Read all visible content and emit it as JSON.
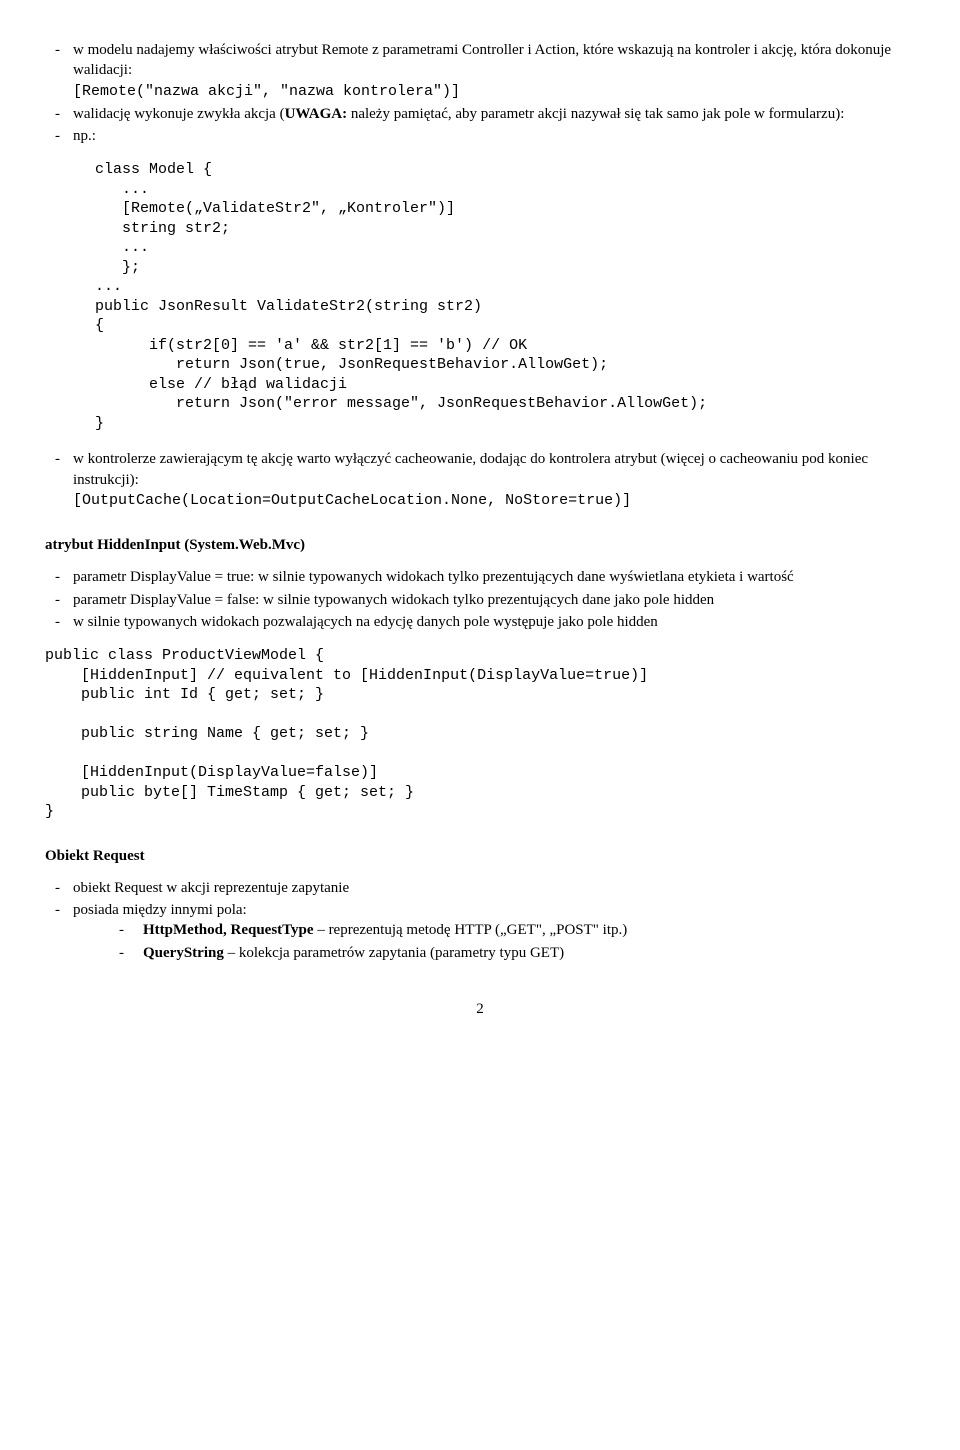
{
  "bullets_top": [
    "w modelu nadajemy właściwości atrybut Remote z parametrami Controller i Action, które wskazują na kontroler i akcję, która dokonuje walidacji:",
    "walidację wykonuje zwykła akcja (",
    "np.:"
  ],
  "bullets_top_remote": "[Remote(″nazwa akcji″, ″nazwa kontrolera″)]",
  "bullets_top_uwaga": "UWAGA:",
  "bullets_top_uwaga_rest": " należy pamiętać, aby parametr akcji nazywał się tak samo jak pole w formularzu):",
  "code1": "class Model {\n   ...\n   [Remote(„ValidateStr2″, „Kontroler″)]\n   string str2;\n   ...\n   };\n...\npublic JsonResult ValidateStr2(string str2)\n{\n      if(str2[0] == 'a' && str2[1] == 'b') // OK\n         return Json(true, JsonRequestBehavior.AllowGet);\n      else // błąd walidacji\n         return Json(\"error message\", JsonRequestBehavior.AllowGet);\n}",
  "bullet_cache_pre": "w kontrolerze zawierającym tę akcję warto wyłączyć cacheowanie, dodając do kontrolera atrybut (więcej o cacheowaniu pod koniec instrukcji):",
  "bullet_cache_code": "[OutputCache(Location=OutputCacheLocation.None, NoStore=true)]",
  "section_hidden": "atrybut HiddenInput (System.Web.Mvc)",
  "bullets_hidden": [
    "parametr DisplayValue = true: w silnie typowanych widokach tylko prezentujących dane wyświetlana etykieta i wartość",
    "parametr DisplayValue = false: w silnie typowanych widokach tylko prezentujących dane jako pole hidden",
    "w silnie typowanych widokach pozwalających na edycję danych pole występuje jako pole hidden"
  ],
  "code2": "public class ProductViewModel {\n    [HiddenInput] // equivalent to [HiddenInput(DisplayValue=true)]\n    public int Id { get; set; }\n\n    public string Name { get; set; }\n\n    [HiddenInput(DisplayValue=false)]\n    public byte[] TimeStamp { get; set; }\n}",
  "section_request": "Obiekt Request",
  "bullets_request": [
    "obiekt Request w akcji reprezentuje zapytanie",
    "posiada między innymi pola:"
  ],
  "bullets_request_inner_1_bold": "HttpMethod, RequestType",
  "bullets_request_inner_1_rest": " – reprezentują metodę HTTP („GET\", „POST\" itp.)",
  "bullets_request_inner_2_bold": "QueryString",
  "bullets_request_inner_2_rest": " – kolekcja parametrów zapytania (parametry typu GET)",
  "pagenum": "2"
}
